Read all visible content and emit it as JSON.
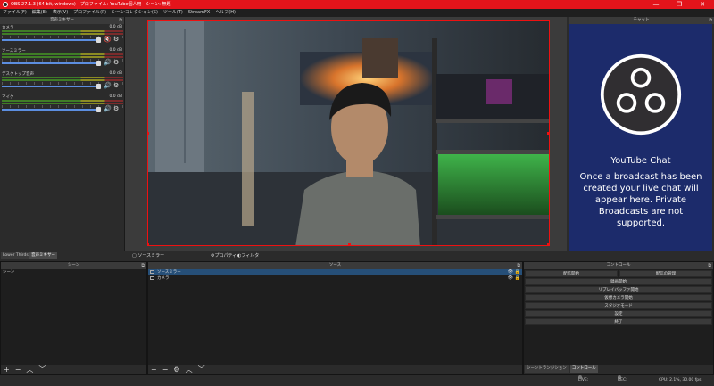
{
  "window": {
    "title": "OBS 27.1.3 (64-bit, windows) - プロファイル: YouTube個人用 - シーン: 無題",
    "minimize": "—",
    "maximize": "❐",
    "close": "✕",
    "titlebar_color": "#e3141b"
  },
  "menu": [
    "ファイル(F)",
    "編集(E)",
    "表示(V)",
    "プロファイル(P)",
    "シーンコレクション(S)",
    "ツール(T)",
    "StreamFX",
    "ヘルプ(H)"
  ],
  "mixer": {
    "title": "音声ミキサー",
    "channels": [
      {
        "name": "カメラ",
        "db": "0.0 dB",
        "muted": true
      },
      {
        "name": "ソースミラー",
        "db": "0.0 dB",
        "muted": false
      },
      {
        "name": "デスクトップ音声",
        "db": "0.0 dB",
        "muted": false
      },
      {
        "name": "マイク",
        "db": "0.0 dB",
        "muted": false
      }
    ]
  },
  "chat": {
    "title": "チャット",
    "heading": "YouTube Chat",
    "message": "Once a broadcast has been created your live chat will appear here. Private Broadcasts are not supported.",
    "background_color": "#1c2b6b"
  },
  "dock_tabs": {
    "lower_thirds": "Lower Thirds",
    "mixer": "音声ミキサー",
    "source_mirror": "ソースミラー",
    "properties": "プロパティ",
    "filters": "フィルタ"
  },
  "scenes": {
    "title": "シーン",
    "items": [
      "シーン"
    ]
  },
  "sources": {
    "title": "ソース",
    "items": [
      {
        "name": "ソースミラー",
        "selected": true
      },
      {
        "name": "カメラ",
        "selected": false
      }
    ]
  },
  "controls": {
    "title": "コントロール",
    "start_streaming": "配信開始",
    "manage_broadcast": "配信の管理",
    "start_recording": "録画開始",
    "start_replay": "リプレイバッファ開始",
    "virtual_camera": "仮想カメラ開始",
    "studio_mode": "スタジオモード",
    "settings": "設定",
    "exit": "終了"
  },
  "bottom_tabs": {
    "scene_transitions": "シーントランジション",
    "controls": "コントロール"
  },
  "footer_buttons": {
    "add": "+",
    "remove": "−",
    "up": "︿",
    "down": "﹀",
    "gear": "⚙"
  },
  "status": {
    "live": "LIVE: 00:00:00",
    "rec": "REC: 00:00:00",
    "cpu": "CPU: 2.1%, 30.00 fps"
  },
  "icons": {
    "speaker": "🔊",
    "speaker_muted": "🔇",
    "gear": "⚙",
    "eye": "👁",
    "lock": "🔒",
    "pin": "⧉"
  },
  "colors": {
    "accent_red": "#e3141b",
    "selection_blue": "#264f78",
    "volume_blue": "#5c8ee0"
  }
}
